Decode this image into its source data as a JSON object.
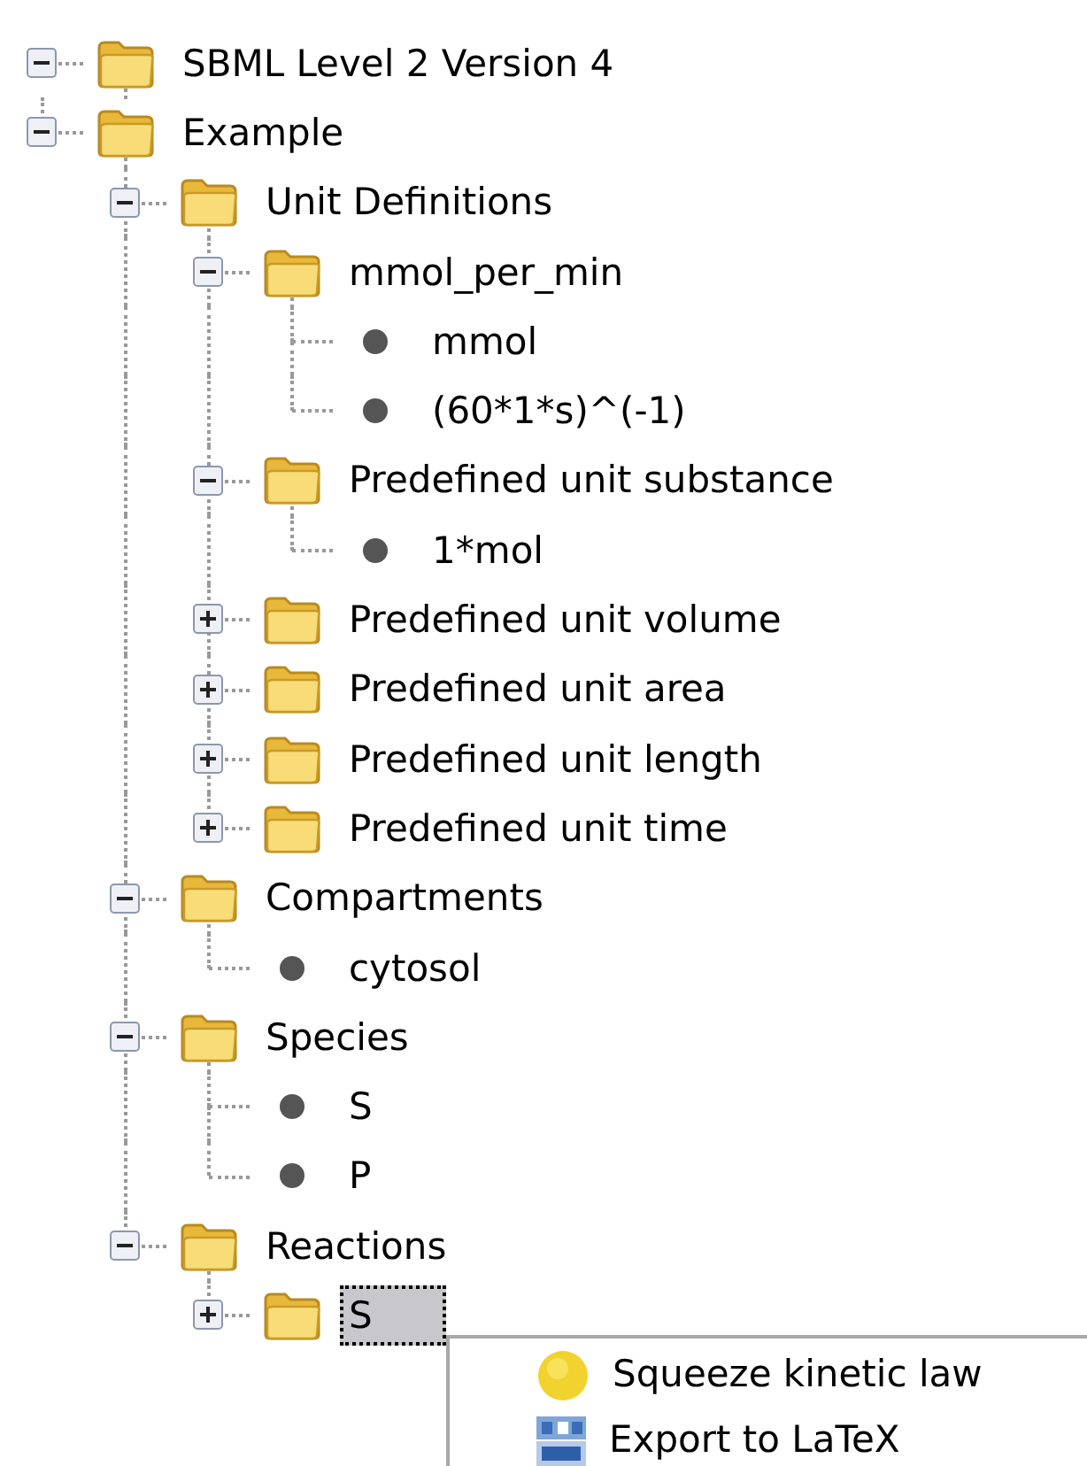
{
  "tree": [
    {
      "label": "SBML Level 2 Version 4",
      "kind": "folder",
      "expanded": true,
      "selected": false,
      "children": [
        {
          "label": "Example",
          "kind": "folder",
          "expanded": true,
          "selected": false,
          "children": [
            {
              "label": "Unit Definitions",
              "kind": "folder",
              "expanded": true,
              "selected": false,
              "children": [
                {
                  "label": "mmol_per_min",
                  "kind": "folder",
                  "expanded": true,
                  "selected": false,
                  "children": [
                    {
                      "label": "mmol",
                      "kind": "leaf",
                      "selected": false
                    },
                    {
                      "label": "(60*1*s)^(-1)",
                      "kind": "leaf",
                      "selected": false
                    }
                  ]
                },
                {
                  "label": "Predefined unit substance",
                  "kind": "folder",
                  "expanded": true,
                  "selected": false,
                  "children": [
                    {
                      "label": "1*mol",
                      "kind": "leaf",
                      "selected": false
                    }
                  ]
                },
                {
                  "label": "Predefined unit volume",
                  "kind": "folder",
                  "expanded": false,
                  "selected": false
                },
                {
                  "label": "Predefined unit area",
                  "kind": "folder",
                  "expanded": false,
                  "selected": false
                },
                {
                  "label": "Predefined unit length",
                  "kind": "folder",
                  "expanded": false,
                  "selected": false
                },
                {
                  "label": "Predefined unit time",
                  "kind": "folder",
                  "expanded": false,
                  "selected": false
                }
              ]
            },
            {
              "label": "Compartments",
              "kind": "folder",
              "expanded": true,
              "selected": false,
              "children": [
                {
                  "label": "cytosol",
                  "kind": "leaf",
                  "selected": false
                }
              ]
            },
            {
              "label": "Species",
              "kind": "folder",
              "expanded": true,
              "selected": false,
              "children": [
                {
                  "label": "S",
                  "kind": "leaf",
                  "selected": false
                },
                {
                  "label": "P",
                  "kind": "leaf",
                  "selected": false
                }
              ]
            },
            {
              "label": "Reactions",
              "kind": "folder",
              "expanded": true,
              "selected": false,
              "children": [
                {
                  "label": "S",
                  "kind": "folder",
                  "expanded": false,
                  "selected": true
                }
              ]
            }
          ]
        }
      ]
    }
  ],
  "context_menu": [
    {
      "label": "Squeeze kinetic law"
    },
    {
      "label": "Export to LaTeX"
    }
  ]
}
